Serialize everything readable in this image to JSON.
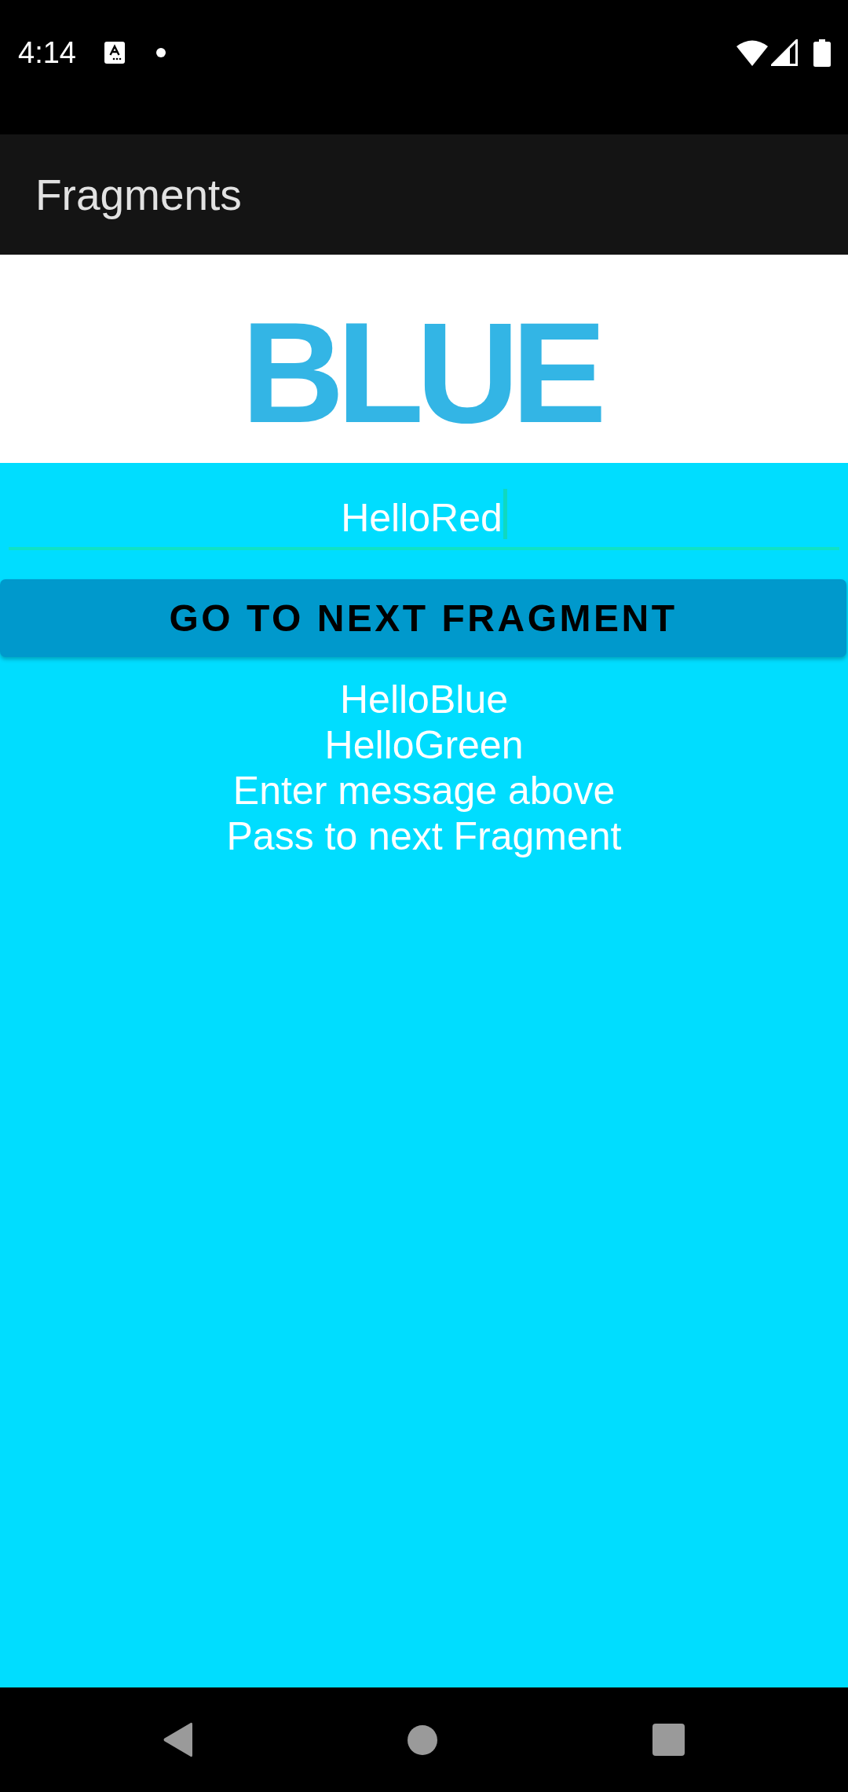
{
  "status_bar": {
    "time": "4:14"
  },
  "app_bar": {
    "title": "Fragments"
  },
  "header": {
    "title": "BLUE"
  },
  "message_field": {
    "value": "HelloRed",
    "focused": true
  },
  "next_button": {
    "label": "GO TO NEXT FRAGMENT"
  },
  "messages": [
    "HelloBlue",
    "HelloGreen",
    "Enter message above",
    "Pass to next Fragment"
  ]
}
